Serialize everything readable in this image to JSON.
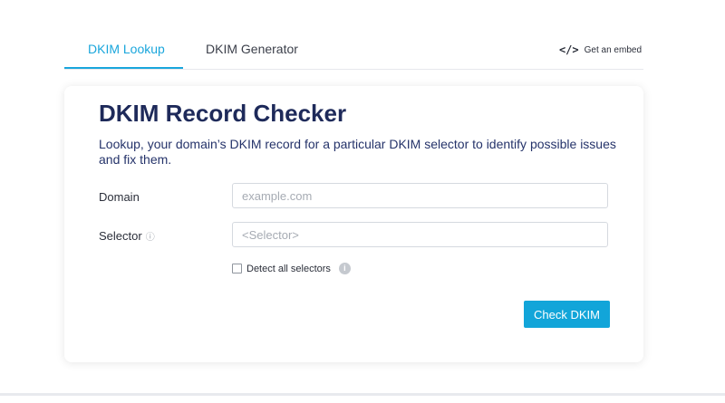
{
  "tabs": {
    "lookup": "DKIM Lookup",
    "generator": "DKIM Generator",
    "embed_label": "Get an embed",
    "embed_icon": "</>"
  },
  "card": {
    "title": "DKIM Record Checker",
    "description": "Lookup, your domain’s DKIM record for a particular DKIM selector to identify possible issues and fix them."
  },
  "form": {
    "domain_label": "Domain",
    "domain_placeholder": "example.com",
    "selector_label": "Selector",
    "selector_info": "ⓘ",
    "selector_placeholder": "<Selector>",
    "detect_label": "Detect all selectors",
    "detect_checked": false,
    "detect_info": "i",
    "submit_label": "Check DKIM"
  },
  "colors": {
    "accent": "#1aa6dc",
    "title": "#1e2a5a",
    "button": "#12a5d9"
  }
}
